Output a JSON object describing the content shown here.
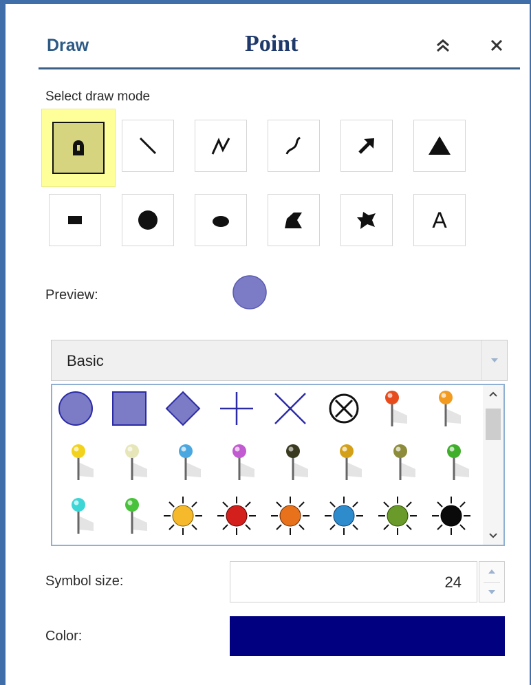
{
  "header": {
    "title": "Draw",
    "subtitle": "Point"
  },
  "icons": {
    "collapse": "double-chevron-up-icon",
    "close": "close-icon"
  },
  "draw_mode": {
    "label": "Select draw mode",
    "modes": [
      "point",
      "line",
      "polyline",
      "freehand-polyline",
      "arrow",
      "triangle",
      "extent",
      "circle",
      "ellipse",
      "polygon",
      "freehand-polygon",
      "text"
    ],
    "selected": "point",
    "text_mode_glyph": "A"
  },
  "preview": {
    "label": "Preview:",
    "symbol_color": "#7b7bc6"
  },
  "symbol_set": {
    "selected": "Basic"
  },
  "symbols": [
    "circle",
    "square",
    "diamond",
    "cross",
    "x",
    "circle-x",
    "pushpin-red",
    "pushpin-orange",
    "pushpin-yellow",
    "pushpin-white",
    "pushpin-blue",
    "pushpin-purple",
    "pushpin-black",
    "pushpin-gold",
    "pushpin-olive",
    "pushpin-green",
    "pushpin-cyan",
    "pushpin-green",
    "sun-yellow",
    "sun-red",
    "sun-orange",
    "sun-blue",
    "sun-green",
    "sun-black"
  ],
  "symbol_size": {
    "label": "Symbol size:",
    "value": "24"
  },
  "color": {
    "label": "Color:",
    "value": "#000080"
  },
  "colors": {
    "accent": "#3f6ea8",
    "symbol_fill": "#7b7bc6",
    "symbol_stroke": "#2b2ba6"
  }
}
